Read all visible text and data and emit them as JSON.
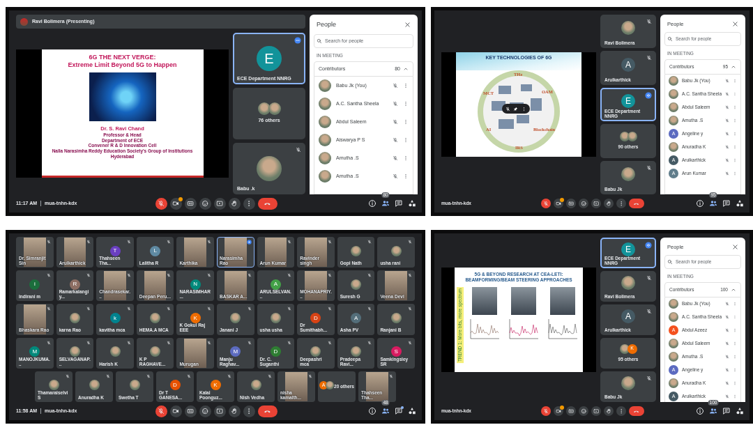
{
  "screenshots": [
    {
      "kind": "presentation",
      "presenter": "Ravi Bolimera (Presenting)",
      "slide": {
        "kind": "title",
        "title_lines": [
          "6G THE NEXT VERGE:",
          "Extreme Limit Beyond 5G to Happen"
        ],
        "author": "Dr. S. Ravi Chand",
        "lines": [
          "Professor & Head",
          "Department of ECE",
          "Convener R & D Innovation Cell",
          "Nalla Narasimha Reddy Education Society's Group of Institutions",
          "Hyderabad"
        ]
      },
      "side_tiles": [
        {
          "name": "ECE Department NNRG",
          "kind": "letter",
          "letter": "E",
          "color": "#12939a",
          "speaking": true,
          "muted": false
        },
        {
          "name": "76 others",
          "kind": "others",
          "avatars": [
            {
              "kind": "picture"
            },
            {
              "kind": "picture"
            }
          ]
        },
        {
          "name": "Babu .k",
          "kind": "picture",
          "speaking": false,
          "muted": true
        }
      ],
      "people": {
        "title": "People",
        "placeholder": "Search for people",
        "section": "IN MEETING",
        "group": "Contributors",
        "count": "80",
        "expanded": true,
        "items": [
          {
            "name": "Babu Jk (You)",
            "kind": "picture"
          },
          {
            "name": "A.C. Santha Sheela",
            "kind": "picture"
          },
          {
            "name": "Abdul Saleem",
            "kind": "picture"
          },
          {
            "name": "Aiswarya P S",
            "kind": "picture"
          },
          {
            "name": "Amutha .S",
            "kind": "picture"
          },
          {
            "name": "Amutha .S",
            "kind": "picture"
          }
        ]
      },
      "bar": {
        "time": "11:17 AM",
        "code": "mua-tnhn-kdx",
        "mic_muted": true,
        "camera_alert": true,
        "people_count": "80",
        "chat_unread": false
      }
    },
    {
      "kind": "presentation",
      "slide": {
        "kind": "diagram",
        "title": "KEY TECHNOLOGIES OF 6G",
        "labels": [
          "THz",
          "OAM",
          "Blockchain",
          "IRS",
          "AI",
          "MCT"
        ],
        "hover_controls": true
      },
      "side_tiles": [
        {
          "name": "Ravi Bolimera",
          "kind": "picture",
          "speaking": false,
          "muted": true
        },
        {
          "name": "Arulkarthick",
          "kind": "letter",
          "letter": "A",
          "color": "#455a64",
          "speaking": false,
          "muted": true
        },
        {
          "name": "ECE Department NNRG",
          "kind": "letter",
          "letter": "E",
          "color": "#12939a",
          "speaking": true,
          "muted": false
        },
        {
          "name": "90 others",
          "kind": "others",
          "avatars": [
            {
              "kind": "picture"
            },
            {
              "kind": "picture"
            }
          ]
        },
        {
          "name": "Babu Jk",
          "kind": "picture",
          "speaking": false,
          "muted": true
        }
      ],
      "people": {
        "title": "People",
        "placeholder": "Search for people",
        "section": "IN MEETING",
        "group": "Contributors",
        "count": "95",
        "expanded": true,
        "items": [
          {
            "name": "Babu Jk (You)",
            "kind": "picture"
          },
          {
            "name": "A.C. Santha Sheela",
            "kind": "picture"
          },
          {
            "name": "Abdul Saleem",
            "kind": "picture"
          },
          {
            "name": "Amutha .S",
            "kind": "picture"
          },
          {
            "name": "Angeline y",
            "kind": "letter",
            "letter": "A",
            "color": "#5c6bc0"
          },
          {
            "name": "Anuradha K",
            "kind": "picture"
          },
          {
            "name": "Arulkarthick",
            "kind": "letter",
            "letter": "A",
            "color": "#455a64"
          },
          {
            "name": "Arun Kumar",
            "kind": "letter",
            "letter": "A",
            "color": "#607d8b"
          }
        ]
      },
      "bar": {
        "code": "mua-tnhn-kdx",
        "mic_muted": true,
        "camera_alert": true,
        "people_count": "95",
        "chat_unread": false
      }
    },
    {
      "kind": "grid",
      "rows": [
        [
          {
            "name": "Dr. Simranjit Sin",
            "kind": "video",
            "muted": true
          },
          {
            "name": "Arulkarthick",
            "kind": "video",
            "muted": true
          },
          {
            "name": "Thahseen Tha...",
            "kind": "letter",
            "letter": "T",
            "color": "#6a3fc1",
            "muted": true
          },
          {
            "name": "Lalitha R",
            "kind": "letter",
            "letter": "L",
            "color": "#5f8aa3",
            "muted": true
          },
          {
            "name": "Karthika",
            "kind": "video",
            "muted": true
          },
          {
            "name": "Narasimha Rao",
            "kind": "video",
            "muted": false,
            "speaking": true
          },
          {
            "name": "Arun Kumar",
            "kind": "video",
            "muted": true
          },
          {
            "name": "Ravinder singh",
            "kind": "video",
            "muted": true
          },
          {
            "name": "Gopi Nath",
            "kind": "picture",
            "muted": true
          },
          {
            "name": "usha rani",
            "kind": "picture",
            "muted": true
          }
        ],
        [
          {
            "name": "indirani m",
            "kind": "letter",
            "letter": "i",
            "color": "#1b6e3c",
            "muted": true
          },
          {
            "name": "Ramarkalangiy...",
            "kind": "letter",
            "letter": "R",
            "color": "#8d6e63",
            "muted": true
          },
          {
            "name": "Chandrasekar...",
            "kind": "video",
            "muted": true
          },
          {
            "name": "Deepan Peru...",
            "kind": "video",
            "muted": true
          },
          {
            "name": "NARASIMHAR...",
            "kind": "letter",
            "letter": "N",
            "color": "#00897b",
            "muted": true
          },
          {
            "name": "BASKAR A...",
            "kind": "video",
            "muted": true
          },
          {
            "name": "ARULSELVAN...",
            "kind": "letter",
            "letter": "A",
            "color": "#43a047",
            "muted": true
          },
          {
            "name": "MOHANAPRIY...",
            "kind": "video",
            "muted": true
          },
          {
            "name": "Suresh G",
            "kind": "picture",
            "muted": true
          },
          {
            "name": "Veena Devi",
            "kind": "video",
            "muted": true
          }
        ],
        [
          {
            "name": "Bhaskara Rao",
            "kind": "video",
            "muted": true
          },
          {
            "name": "karna Rao",
            "kind": "picture",
            "muted": true
          },
          {
            "name": "kavitha mca",
            "kind": "letter",
            "letter": "k",
            "color": "#00838f",
            "muted": true
          },
          {
            "name": "HEMA.A MCA",
            "kind": "picture",
            "muted": true
          },
          {
            "name": "K Gokul Raj EEE",
            "kind": "letter",
            "letter": "K",
            "color": "#ef6c00",
            "muted": true
          },
          {
            "name": "Janani J",
            "kind": "picture",
            "muted": true
          },
          {
            "name": "usha usha",
            "kind": "picture",
            "muted": true
          },
          {
            "name": "Dr Sumithabh...",
            "kind": "letter",
            "letter": "D",
            "color": "#d84315",
            "muted": true
          },
          {
            "name": "Asha PV",
            "kind": "letter",
            "letter": "A",
            "color": "#546e7a",
            "muted": true
          },
          {
            "name": "Ranjani B",
            "kind": "picture",
            "muted": true
          }
        ],
        [
          {
            "name": "MANOJKUMA...",
            "kind": "letter",
            "letter": "M",
            "color": "#00897b",
            "muted": true
          },
          {
            "name": "SELVAGANAP...",
            "kind": "picture",
            "muted": true
          },
          {
            "name": "Harish K",
            "kind": "picture",
            "muted": true
          },
          {
            "name": "K P RAGHAVE...",
            "kind": "picture",
            "muted": true
          },
          {
            "name": "Murugan",
            "kind": "video",
            "muted": true
          },
          {
            "name": "Manju Raghav...",
            "kind": "letter",
            "letter": "M",
            "color": "#5c6bc0",
            "muted": true
          },
          {
            "name": "Dr. C. Suganthi",
            "kind": "letter",
            "letter": "D",
            "color": "#2e7d32",
            "muted": true
          },
          {
            "name": "Deepashri mca",
            "kind": "picture",
            "muted": true
          },
          {
            "name": "Pradeepa Ravi...",
            "kind": "picture",
            "muted": true
          },
          {
            "name": "Samkingsley SR",
            "kind": "letter",
            "letter": "S",
            "color": "#d81b60",
            "muted": true
          }
        ],
        [
          {
            "name": "Thamaraiselvi S",
            "kind": "picture",
            "muted": true
          },
          {
            "name": "Anuradha K",
            "kind": "picture",
            "muted": true
          },
          {
            "name": "Swetha T",
            "kind": "picture",
            "muted": true
          },
          {
            "name": "Dr T GANESA...",
            "kind": "letter",
            "letter": "D",
            "color": "#e65100",
            "muted": true
          },
          {
            "name": "Kalai Poonguz...",
            "kind": "letter",
            "letter": "K",
            "color": "#ef6c00",
            "muted": true
          },
          {
            "name": "Nish Vedha",
            "kind": "picture",
            "muted": true
          },
          {
            "name": "nisha kamalth...",
            "kind": "video",
            "muted": true
          },
          {
            "name": "20 others",
            "kind": "others",
            "avatars": [
              {
                "kind": "letter",
                "letter": "A",
                "color": "#ef6c00"
              },
              {
                "kind": "picture"
              }
            ]
          },
          {
            "name": "Thahseen Tha...",
            "kind": "video",
            "muted": true
          }
        ]
      ],
      "bar": {
        "time": "11:58 AM",
        "code": "mua-tnhn-kdx",
        "mic_muted": true,
        "camera_alert": false,
        "people_count": "48",
        "chat_unread": true
      }
    },
    {
      "kind": "presentation",
      "slide": {
        "kind": "research",
        "title_lines": [
          "5G & BEYOND RESEARCH AT CEA-LETI:",
          "BEAMFORMING/BEAM STEERING APPROACHES"
        ],
        "side_label": "TREND 1: More bits, more spectrum"
      },
      "side_tiles": [
        {
          "name": "ECE Department NNRG",
          "kind": "letter",
          "letter": "E",
          "color": "#12939a",
          "speaking": true,
          "muted": false
        },
        {
          "name": "Ravi Bolimera",
          "kind": "picture",
          "speaking": false,
          "muted": true
        },
        {
          "name": "Arulkarthick",
          "kind": "letter",
          "letter": "A",
          "color": "#455a64",
          "speaking": false,
          "muted": true
        },
        {
          "name": "95 others",
          "kind": "others",
          "avatars": [
            {
              "kind": "picture"
            },
            {
              "kind": "letter",
              "letter": "K",
              "color": "#ef6c00"
            }
          ]
        },
        {
          "name": "Babu Jk",
          "kind": "picture",
          "speaking": false,
          "muted": true
        }
      ],
      "people": {
        "title": "People",
        "placeholder": "Search for people",
        "section": "IN MEETING",
        "group": "Contributors",
        "count": "100",
        "expanded": true,
        "items": [
          {
            "name": "Babu Jk (You)",
            "kind": "picture"
          },
          {
            "name": "A.C. Santha Sheela",
            "kind": "picture"
          },
          {
            "name": "Abdul Azeez",
            "kind": "letter",
            "letter": "A",
            "color": "#f4511e"
          },
          {
            "name": "Abdul Saleem",
            "kind": "picture"
          },
          {
            "name": "Amutha .S",
            "kind": "picture"
          },
          {
            "name": "Angeline y",
            "kind": "letter",
            "letter": "A",
            "color": "#5c6bc0"
          },
          {
            "name": "Anuradha K",
            "kind": "picture"
          },
          {
            "name": "Arulkarthick",
            "kind": "letter",
            "letter": "A",
            "color": "#455a64"
          }
        ]
      },
      "bar": {
        "code": "mua-tnhn-kdx",
        "mic_muted": true,
        "camera_alert": true,
        "people_count": "100",
        "chat_unread": false
      }
    }
  ]
}
